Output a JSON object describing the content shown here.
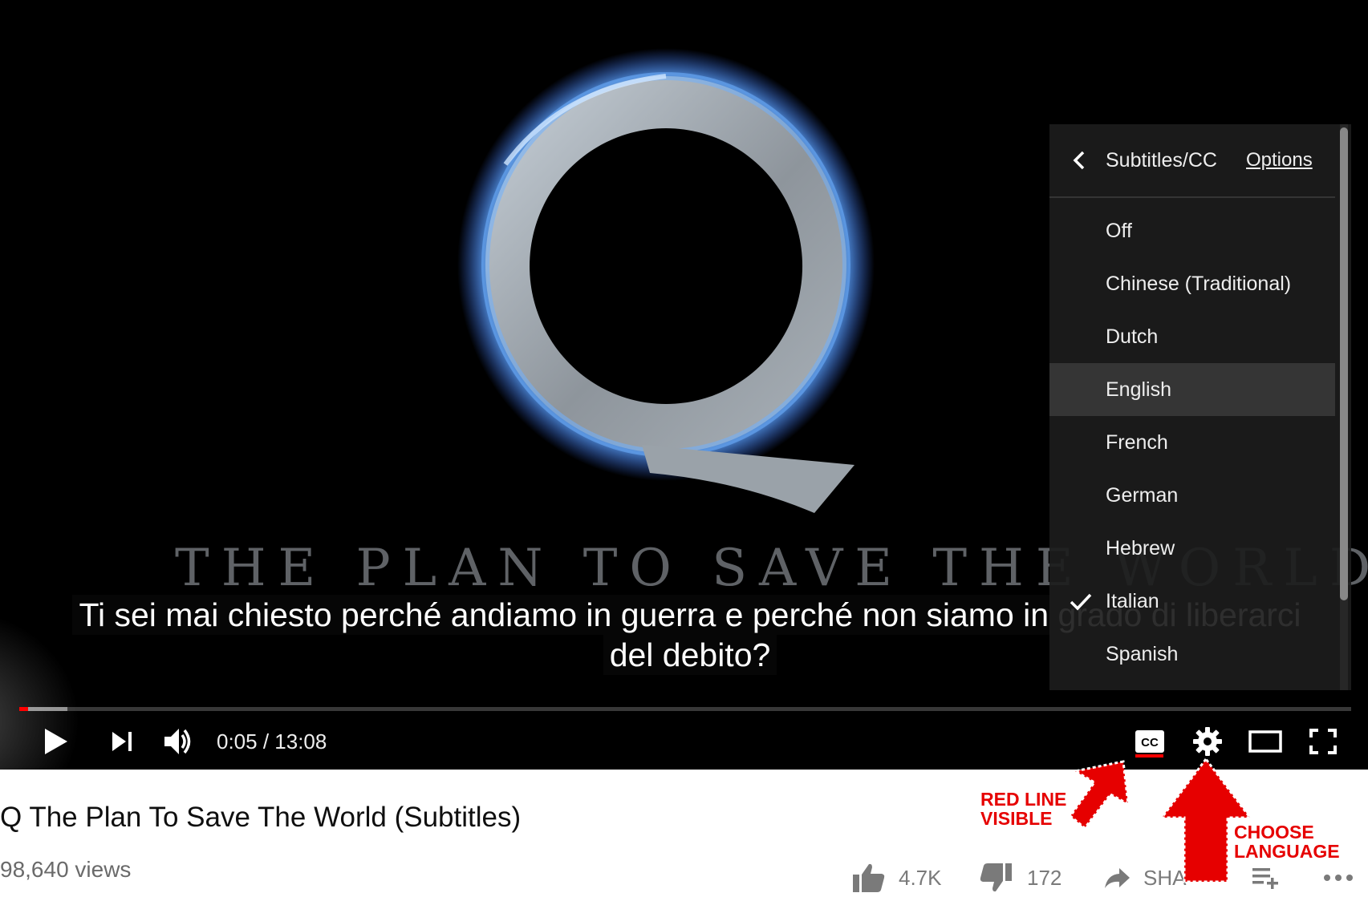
{
  "video": {
    "art_title": "THE PLAN TO SAVE THE WORLD",
    "caption_line1": "Ti sei mai chiesto perché andiamo in guerra e perché non siamo in grado di liberarci",
    "caption_line2": "del debito?"
  },
  "player": {
    "time": "0:05 / 13:08",
    "progress_fraction": 0.0064,
    "progress_color": "#ff0000"
  },
  "subtitles_menu": {
    "title": "Subtitles/CC",
    "options_link": "Options",
    "items": [
      {
        "label": "Off"
      },
      {
        "label": "Chinese (Traditional)"
      },
      {
        "label": "Dutch"
      },
      {
        "label": "English",
        "highlighted": true
      },
      {
        "label": "French"
      },
      {
        "label": "German"
      },
      {
        "label": "Hebrew"
      },
      {
        "label": "Italian",
        "selected": true
      },
      {
        "label": "Spanish"
      }
    ]
  },
  "page": {
    "title": "Q The Plan To Save The World (Subtitles)",
    "views": "98,640 views",
    "likes": "4.7K",
    "dislikes": "172",
    "share_label": "SHA"
  },
  "annotations": {
    "red_line_line1": "RED LINE",
    "red_line_line2": "VISIBLE",
    "choose_line1": "CHOOSE",
    "choose_line2": "LANGUAGE",
    "color": "#e60000"
  },
  "icons": [
    "play-icon",
    "next-icon",
    "volume-icon",
    "cc-icon",
    "gear-icon",
    "theater-icon",
    "fullscreen-icon",
    "chevron-left-icon",
    "check-icon",
    "thumbs-up-icon",
    "thumbs-down-icon",
    "share-icon",
    "add-to-playlist-icon",
    "more-icon"
  ]
}
